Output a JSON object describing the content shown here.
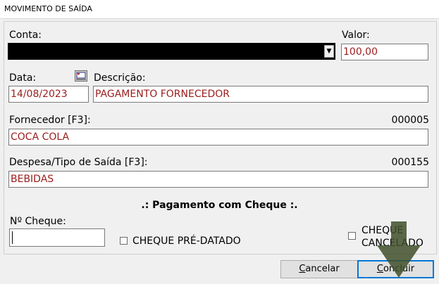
{
  "window": {
    "title": "MOVIMENTO DE SAÍDA"
  },
  "form": {
    "conta_label": "Conta:",
    "valor_label": "Valor:",
    "valor_value": "100,00",
    "data_label": "Data:",
    "data_value": "14/08/2023",
    "descricao_label": "Descrição:",
    "descricao_value": "PAGAMENTO FORNECEDOR",
    "fornecedor_label": "Fornecedor [F3]:",
    "fornecedor_code": "000005",
    "fornecedor_value": "COCA COLA",
    "despesa_label": "Despesa/Tipo de Saída [F3]:",
    "despesa_code": "000155",
    "despesa_value": "BEBIDAS"
  },
  "cheque": {
    "section_title": ".: Pagamento com Cheque :.",
    "numero_label": "Nº Cheque:",
    "predatado_label": "CHEQUE PRÉ-DATADO",
    "cancelado_line1": "CHEQUE",
    "cancelado_line2": "CANCELADO"
  },
  "buttons": {
    "cancelar_first": "C",
    "cancelar_rest": "ancelar",
    "concluir_first": "C",
    "concluir_rest": "oncluir"
  },
  "colors": {
    "field_text": "#9b1c1c",
    "arrow": "#3f4f2a"
  },
  "icons": {
    "dropdown": "chevron-down-icon",
    "calendar": "calendar-icon",
    "annotation": "arrow-down-icon"
  }
}
